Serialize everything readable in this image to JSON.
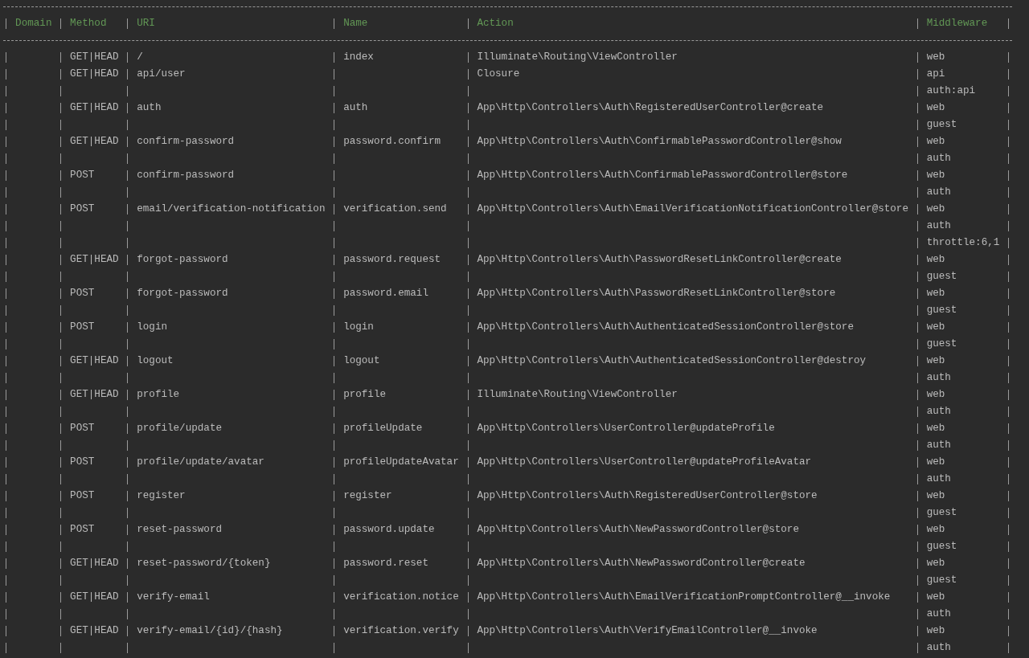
{
  "table": {
    "columns": [
      "Domain",
      "Method",
      "URI",
      "Name",
      "Action",
      "Middleware"
    ],
    "rows": [
      {
        "method": "GET|HEAD",
        "uri": "/",
        "name": "index",
        "action": "Illuminate\\Routing\\ViewController",
        "middleware": [
          "web"
        ]
      },
      {
        "method": "GET|HEAD",
        "uri": "api/user",
        "action": "Closure",
        "middleware": [
          "api",
          "auth:api"
        ]
      },
      {
        "method": "GET|HEAD",
        "uri": "auth",
        "name": "auth",
        "action": "App\\Http\\Controllers\\Auth\\RegisteredUserController@create",
        "middleware": [
          "web",
          "guest"
        ]
      },
      {
        "method": "GET|HEAD",
        "uri": "confirm-password",
        "name": "password.confirm",
        "action": "App\\Http\\Controllers\\Auth\\ConfirmablePasswordController@show",
        "middleware": [
          "web",
          "auth"
        ]
      },
      {
        "method": "POST",
        "uri": "confirm-password",
        "action": "App\\Http\\Controllers\\Auth\\ConfirmablePasswordController@store",
        "middleware": [
          "web",
          "auth"
        ]
      },
      {
        "method": "POST",
        "uri": "email/verification-notification",
        "name": "verification.send",
        "action": "App\\Http\\Controllers\\Auth\\EmailVerificationNotificationController@store",
        "middleware": [
          "web",
          "auth",
          "throttle:6,1"
        ]
      },
      {
        "method": "GET|HEAD",
        "uri": "forgot-password",
        "name": "password.request",
        "action": "App\\Http\\Controllers\\Auth\\PasswordResetLinkController@create",
        "middleware": [
          "web",
          "guest"
        ]
      },
      {
        "method": "POST",
        "uri": "forgot-password",
        "name": "password.email",
        "action": "App\\Http\\Controllers\\Auth\\PasswordResetLinkController@store",
        "middleware": [
          "web",
          "guest"
        ]
      },
      {
        "method": "POST",
        "uri": "login",
        "name": "login",
        "action": "App\\Http\\Controllers\\Auth\\AuthenticatedSessionController@store",
        "middleware": [
          "web",
          "guest"
        ]
      },
      {
        "method": "GET|HEAD",
        "uri": "logout",
        "name": "logout",
        "action": "App\\Http\\Controllers\\Auth\\AuthenticatedSessionController@destroy",
        "middleware": [
          "web",
          "auth"
        ]
      },
      {
        "method": "GET|HEAD",
        "uri": "profile",
        "name": "profile",
        "action": "Illuminate\\Routing\\ViewController",
        "middleware": [
          "web",
          "auth"
        ]
      },
      {
        "method": "POST",
        "uri": "profile/update",
        "name": "profileUpdate",
        "action": "App\\Http\\Controllers\\UserController@updateProfile",
        "middleware": [
          "web",
          "auth"
        ]
      },
      {
        "method": "POST",
        "uri": "profile/update/avatar",
        "name": "profileUpdateAvatar",
        "action": "App\\Http\\Controllers\\UserController@updateProfileAvatar",
        "middleware": [
          "web",
          "auth"
        ]
      },
      {
        "method": "POST",
        "uri": "register",
        "name": "register",
        "action": "App\\Http\\Controllers\\Auth\\RegisteredUserController@store",
        "middleware": [
          "web",
          "guest"
        ]
      },
      {
        "method": "POST",
        "uri": "reset-password",
        "name": "password.update",
        "action": "App\\Http\\Controllers\\Auth\\NewPasswordController@store",
        "middleware": [
          "web",
          "guest"
        ]
      },
      {
        "method": "GET|HEAD",
        "uri": "reset-password/{token}",
        "name": "password.reset",
        "action": "App\\Http\\Controllers\\Auth\\NewPasswordController@create",
        "middleware": [
          "web",
          "guest"
        ]
      },
      {
        "method": "GET|HEAD",
        "uri": "verify-email",
        "name": "verification.notice",
        "action": "App\\Http\\Controllers\\Auth\\EmailVerificationPromptController@__invoke",
        "middleware": [
          "web",
          "auth"
        ]
      },
      {
        "method": "GET|HEAD",
        "uri": "verify-email/{id}/{hash}",
        "name": "verification.verify",
        "action": "App\\Http\\Controllers\\Auth\\VerifyEmailController@__invoke",
        "middleware": [
          "web",
          "auth"
        ]
      }
    ]
  }
}
